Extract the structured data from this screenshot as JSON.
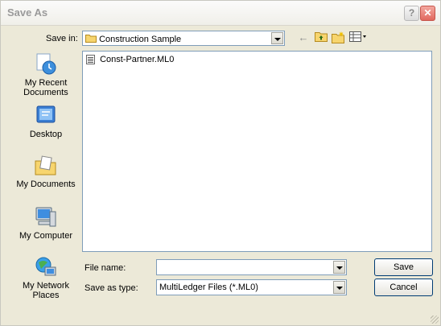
{
  "window": {
    "title": "Save As",
    "help_glyph": "?",
    "close_glyph": "✕"
  },
  "toolbar": {
    "save_in_label": "Save in:",
    "save_in_value": "Construction Sample",
    "icons": [
      "back-arrow-icon",
      "up-folder-icon",
      "new-folder-icon",
      "view-menu-icon"
    ]
  },
  "places": [
    {
      "id": "recent",
      "label": "My Recent Documents"
    },
    {
      "id": "desktop",
      "label": "Desktop"
    },
    {
      "id": "documents",
      "label": "My Documents"
    },
    {
      "id": "computer",
      "label": "My Computer"
    },
    {
      "id": "network",
      "label": "My Network Places"
    }
  ],
  "files": [
    {
      "name": "Const-Partner.ML0",
      "icon": "document-icon"
    }
  ],
  "file_name": {
    "label": "File name:",
    "value": ""
  },
  "save_as_type": {
    "label": "Save as type:",
    "value": "MultiLedger Files (*.ML0)"
  },
  "buttons": {
    "save": "Save",
    "cancel": "Cancel"
  }
}
